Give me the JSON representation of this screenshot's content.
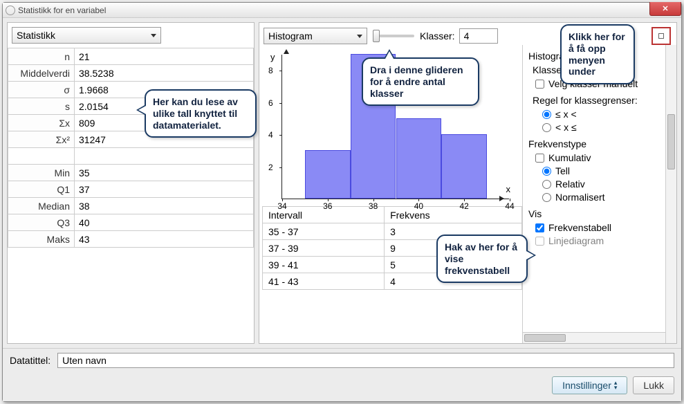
{
  "window": {
    "title": "Statistikk for en variabel"
  },
  "left": {
    "dropdown": "Statistikk",
    "rows": [
      {
        "label": "n",
        "value": "21"
      },
      {
        "label": "Middelverdi",
        "value": "38.5238"
      },
      {
        "label": "σ",
        "value": "1.9668"
      },
      {
        "label": "s",
        "value": "2.0154"
      },
      {
        "label": "Σx",
        "value": "809"
      },
      {
        "label": "Σx²",
        "value": "31247"
      },
      {
        "label": "",
        "value": ""
      },
      {
        "label": "Min",
        "value": "35"
      },
      {
        "label": "Q1",
        "value": "37"
      },
      {
        "label": "Median",
        "value": "38"
      },
      {
        "label": "Q3",
        "value": "40"
      },
      {
        "label": "Maks",
        "value": "43"
      }
    ]
  },
  "right": {
    "dropdown": "Histogram",
    "klasser_label": "Klasser:",
    "klasser_value": "4",
    "side": {
      "histogram_heading": "Histogram",
      "klasser_heading": "Klasser",
      "velg_manuelt": "Velg klasser manuelt",
      "regel_heading": "Regel for klassegrenser:",
      "regel_opt1": "≤ x <",
      "regel_opt2": "< x ≤",
      "frekvenstype_heading": "Frekvenstype",
      "kumulativ": "Kumulativ",
      "tell": "Tell",
      "relativ": "Relativ",
      "normalisert": "Normalisert",
      "vis_heading": "Vis",
      "frekvenstabell": "Frekvenstabell",
      "linjediagram": "Linjediagram"
    },
    "freq_headers": {
      "intervall": "Intervall",
      "frekvens": "Frekvens"
    },
    "freq_rows": [
      {
        "interval": "35 - 37",
        "freq": "3"
      },
      {
        "interval": "37 - 39",
        "freq": "9"
      },
      {
        "interval": "39 - 41",
        "freq": "5"
      },
      {
        "interval": "41 - 43",
        "freq": "4"
      }
    ]
  },
  "axes": {
    "y_label": "y",
    "x_label": "x"
  },
  "callouts": {
    "c1": "Her kan du lese av ulike tall knyttet til datamaterialet.",
    "c2": "Dra i denne glideren for å endre antal klasser",
    "c3": "Klikk her for å få opp menyen under",
    "c4": "Hak av her for å vise frekvenstabell"
  },
  "footer": {
    "label": "Datatittel:",
    "value": "Uten navn",
    "innstillinger": "Innstillinger",
    "lukk": "Lukk"
  },
  "chart_data": {
    "type": "bar",
    "title": "",
    "xlabel": "x",
    "ylabel": "y",
    "x_ticks": [
      34,
      36,
      38,
      40,
      42,
      44
    ],
    "y_ticks": [
      2,
      4,
      6,
      8
    ],
    "ylim": [
      0,
      9
    ],
    "xlim": [
      34,
      44
    ],
    "series": [
      {
        "name": "Frekvens",
        "x_edges": [
          35,
          37,
          39,
          41,
          43
        ],
        "values": [
          3,
          9,
          5,
          4
        ]
      }
    ]
  }
}
